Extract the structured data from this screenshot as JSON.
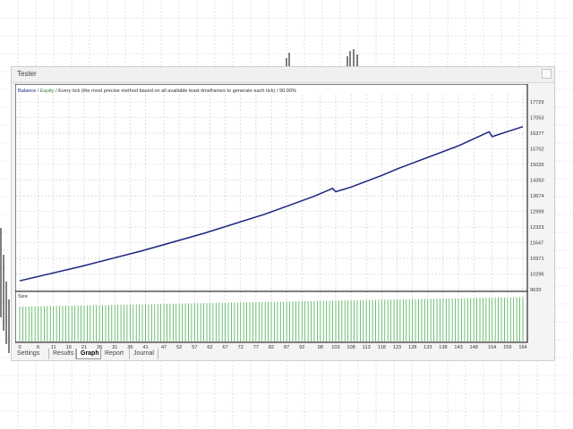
{
  "window": {
    "title": "Tester"
  },
  "chart": {
    "header": {
      "balance": "Balance",
      "sep1": " / ",
      "equity": "Equity",
      "rest": " / Every tick (the most precise method based on all available least timeframes to generate each tick) / 90.00%"
    },
    "size_label": "Size",
    "colors": {
      "balance": "#1a237e",
      "equity": "#2e7d32",
      "size_bars": "#4caf50",
      "grid": "#c8c8c8"
    }
  },
  "chart_data": {
    "type": "line",
    "title": "",
    "y_ticks": [
      "17729",
      "17053",
      "16377",
      "15702",
      "15026",
      "14350",
      "13674",
      "12999",
      "12323",
      "11647",
      "10971",
      "10296",
      "9620"
    ],
    "x_ticks": [
      "0",
      "6",
      "11",
      "16",
      "21",
      "26",
      "31",
      "36",
      "41",
      "47",
      "52",
      "57",
      "62",
      "67",
      "72",
      "77",
      "82",
      "87",
      "92",
      "98",
      "103",
      "108",
      "113",
      "118",
      "123",
      "128",
      "133",
      "138",
      "143",
      "148",
      "154",
      "159",
      "164"
    ],
    "ylim": [
      9620,
      17729
    ],
    "xlim": [
      0,
      164
    ],
    "series": [
      {
        "name": "Balance",
        "x": [
          0,
          20,
          40,
          60,
          80,
          96,
          102,
          103,
          108,
          118,
          123,
          143,
          153,
          154,
          164
        ],
        "y": [
          10000,
          10620,
          11300,
          12050,
          12880,
          13650,
          13990,
          13850,
          14050,
          14550,
          14830,
          15830,
          16440,
          16230,
          16660
        ]
      }
    ],
    "size_series": {
      "x_start": 0,
      "x_end": 164,
      "values_start": 0.72,
      "values_end": 0.92
    }
  },
  "tabs": [
    {
      "label": "Settings",
      "active": false
    },
    {
      "label": "Results",
      "active": false
    },
    {
      "label": "Graph",
      "active": true
    },
    {
      "label": "Report",
      "active": false
    },
    {
      "label": "Journal",
      "active": false
    }
  ]
}
